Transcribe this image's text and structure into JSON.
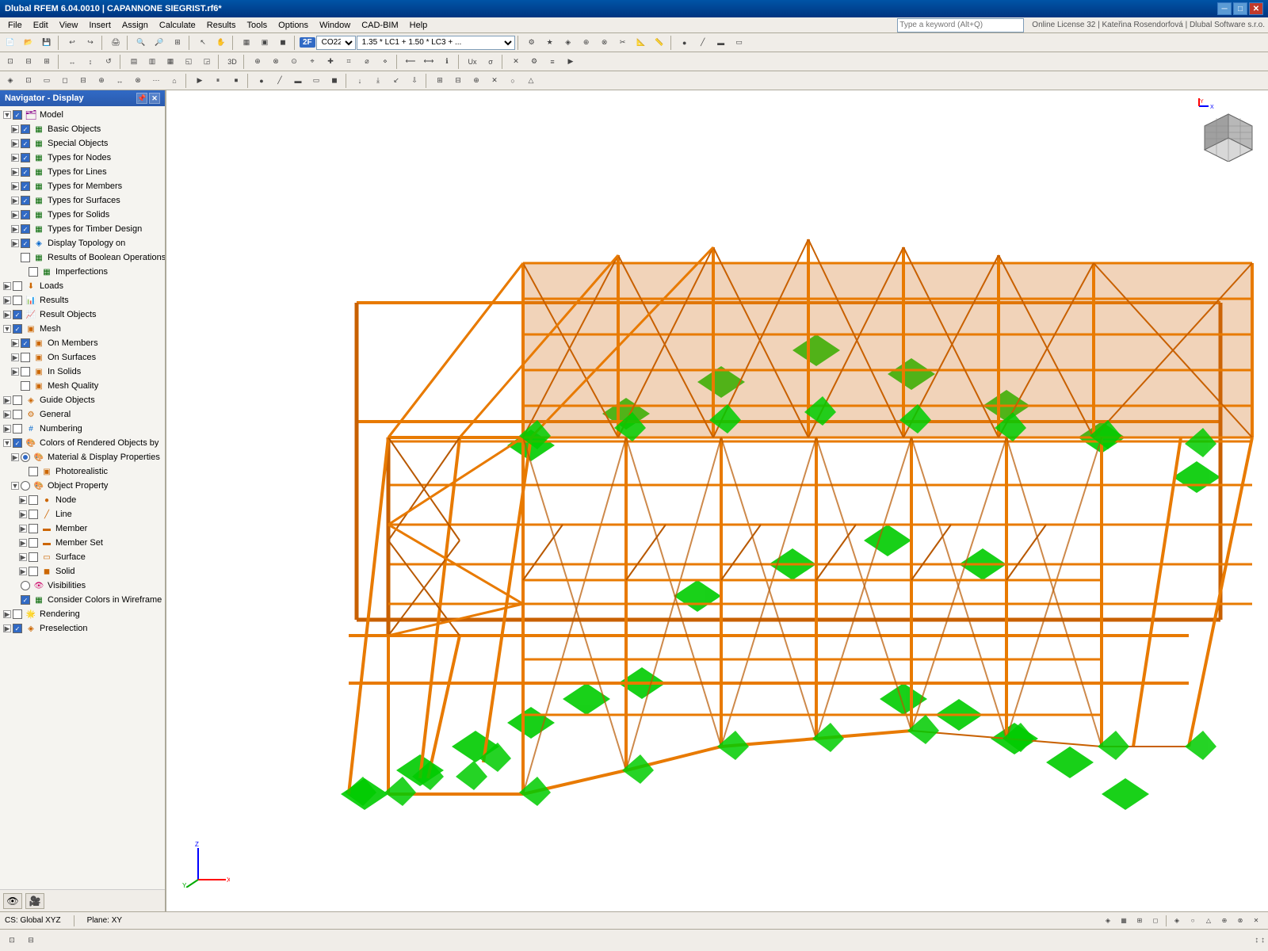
{
  "titlebar": {
    "title": "Dlubal RFEM 6.04.0010 | CAPANNONE SIEGRIST.rf6*",
    "controls": [
      "_",
      "□",
      "✕"
    ]
  },
  "menubar": {
    "items": [
      "File",
      "Edit",
      "View",
      "Insert",
      "Assign",
      "Calculate",
      "Results",
      "Tools",
      "Options",
      "Window",
      "CAD-BIM",
      "Help"
    ]
  },
  "toolbar2": {
    "badge": "2F",
    "combo1": "CO22",
    "combo2": "1.35 * LC1 + 1.50 * LC3 + ...",
    "search_placeholder": "Type a keyword (Alt+Q)"
  },
  "license_info": "Online License 32 | Kateřina Rosendorfová | Dlubal Software s.r.o.",
  "navigator": {
    "title": "Navigator - Display",
    "tree": [
      {
        "id": "model",
        "label": "Model",
        "level": 0,
        "expand": true,
        "check": "checked",
        "icon": "model"
      },
      {
        "id": "basic-objects",
        "label": "Basic Objects",
        "level": 1,
        "expand": false,
        "check": "checked",
        "icon": "basic"
      },
      {
        "id": "special-objects",
        "label": "Special Objects",
        "level": 1,
        "expand": false,
        "check": "checked",
        "icon": "basic"
      },
      {
        "id": "types-nodes",
        "label": "Types for Nodes",
        "level": 1,
        "expand": false,
        "check": "checked",
        "icon": "basic"
      },
      {
        "id": "types-lines",
        "label": "Types for Lines",
        "level": 1,
        "expand": false,
        "check": "checked",
        "icon": "basic"
      },
      {
        "id": "types-members",
        "label": "Types for Members",
        "level": 1,
        "expand": false,
        "check": "checked",
        "icon": "basic"
      },
      {
        "id": "types-surfaces",
        "label": "Types for Surfaces",
        "level": 1,
        "expand": false,
        "check": "checked",
        "icon": "basic"
      },
      {
        "id": "types-solids",
        "label": "Types for Solids",
        "level": 1,
        "expand": false,
        "check": "checked",
        "icon": "basic"
      },
      {
        "id": "types-timber",
        "label": "Types for Timber Design",
        "level": 1,
        "expand": false,
        "check": "checked",
        "icon": "basic"
      },
      {
        "id": "display-topology",
        "label": "Display Topology on",
        "level": 1,
        "expand": false,
        "check": "checked",
        "icon": "display"
      },
      {
        "id": "boolean-results",
        "label": "Results of Boolean Operations",
        "level": 1,
        "expand": false,
        "check": "unchecked",
        "icon": "basic"
      },
      {
        "id": "imperfections",
        "label": "Imperfections",
        "level": 2,
        "expand": false,
        "check": "unchecked",
        "icon": "basic"
      },
      {
        "id": "loads",
        "label": "Loads",
        "level": 0,
        "expand": false,
        "check": "unchecked",
        "icon": "general"
      },
      {
        "id": "results",
        "label": "Results",
        "level": 0,
        "expand": false,
        "check": "unchecked",
        "icon": "result"
      },
      {
        "id": "result-objects",
        "label": "Result Objects",
        "level": 0,
        "expand": false,
        "check": "checked",
        "icon": "result"
      },
      {
        "id": "mesh",
        "label": "Mesh",
        "level": 0,
        "expand": true,
        "check": "checked",
        "icon": "mesh"
      },
      {
        "id": "on-members",
        "label": "On Members",
        "level": 1,
        "expand": false,
        "check": "checked",
        "icon": "mesh"
      },
      {
        "id": "on-surfaces",
        "label": "On Surfaces",
        "level": 1,
        "expand": false,
        "check": "unchecked",
        "icon": "mesh"
      },
      {
        "id": "in-solids",
        "label": "In Solids",
        "level": 1,
        "expand": false,
        "check": "unchecked",
        "icon": "mesh"
      },
      {
        "id": "mesh-quality",
        "label": "Mesh Quality",
        "level": 1,
        "expand": false,
        "check": "unchecked",
        "icon": "mesh"
      },
      {
        "id": "guide-objects",
        "label": "Guide Objects",
        "level": 0,
        "expand": false,
        "check": "unchecked",
        "icon": "general"
      },
      {
        "id": "general",
        "label": "General",
        "level": 0,
        "expand": false,
        "check": "unchecked",
        "icon": "general"
      },
      {
        "id": "numbering",
        "label": "Numbering",
        "level": 0,
        "expand": false,
        "check": "unchecked",
        "icon": "display"
      },
      {
        "id": "colors-rendered",
        "label": "Colors of Rendered Objects by",
        "level": 0,
        "expand": true,
        "check": "checked",
        "icon": "color"
      },
      {
        "id": "material-display",
        "label": "Material & Display Properties",
        "level": 1,
        "expand": false,
        "check": "radio-selected",
        "icon": "color"
      },
      {
        "id": "photorealistic",
        "label": "Photorealistic",
        "level": 2,
        "expand": false,
        "check": "unchecked",
        "icon": "mesh"
      },
      {
        "id": "object-property",
        "label": "Object Property",
        "level": 1,
        "expand": true,
        "check": "radio-empty",
        "icon": "color"
      },
      {
        "id": "node",
        "label": "Node",
        "level": 2,
        "expand": false,
        "check": "unchecked",
        "icon": "mesh"
      },
      {
        "id": "line",
        "label": "Line",
        "level": 2,
        "expand": false,
        "check": "unchecked",
        "icon": "mesh"
      },
      {
        "id": "member",
        "label": "Member",
        "level": 2,
        "expand": false,
        "check": "unchecked",
        "icon": "mesh"
      },
      {
        "id": "member-set",
        "label": "Member Set",
        "level": 2,
        "expand": false,
        "check": "unchecked",
        "icon": "mesh"
      },
      {
        "id": "surface",
        "label": "Surface",
        "level": 2,
        "expand": false,
        "check": "unchecked",
        "icon": "mesh"
      },
      {
        "id": "solid",
        "label": "Solid",
        "level": 2,
        "expand": false,
        "check": "unchecked",
        "icon": "mesh"
      },
      {
        "id": "visibilities",
        "label": "Visibilities",
        "level": 1,
        "expand": false,
        "check": "radio-empty",
        "icon": "color"
      },
      {
        "id": "consider-colors",
        "label": "Consider Colors in Wireframe ...",
        "level": 1,
        "expand": false,
        "check": "checked",
        "icon": "basic"
      },
      {
        "id": "rendering",
        "label": "Rendering",
        "level": 0,
        "expand": false,
        "check": "unchecked",
        "icon": "general"
      },
      {
        "id": "preselection",
        "label": "Preselection",
        "level": 0,
        "expand": false,
        "check": "checked",
        "icon": "mesh"
      }
    ]
  },
  "statusbar": {
    "cs": "CS: Global XYZ",
    "plane": "Plane: XY"
  },
  "nav_buttons": [
    "👁",
    "🎥"
  ],
  "viewport": {
    "background_color": "#ffffff",
    "structure_color": "#e87a00",
    "support_color": "#00cc00"
  }
}
